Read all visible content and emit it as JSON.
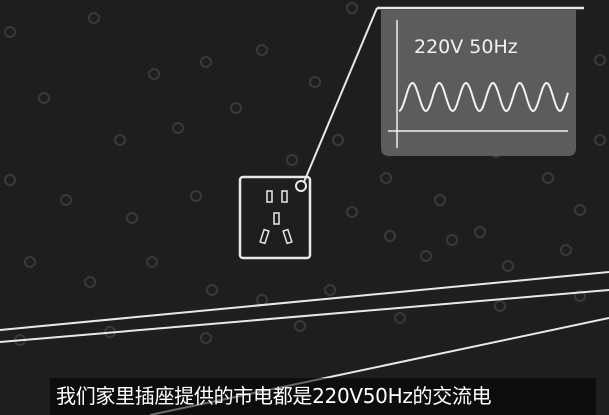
{
  "scene": {
    "background": "#1e1e1e",
    "line_color": "#e8e8e8",
    "dot_color": "#3a3a3a",
    "callout": {
      "label": "220V 50Hz",
      "panel_color": "#5c5c5c",
      "icon": "sine-wave-icon"
    },
    "socket": {
      "icon": "power-socket-icon"
    }
  },
  "subtitle": {
    "text": "我们家里插座提供的市电都是220V50Hz的交流电"
  }
}
